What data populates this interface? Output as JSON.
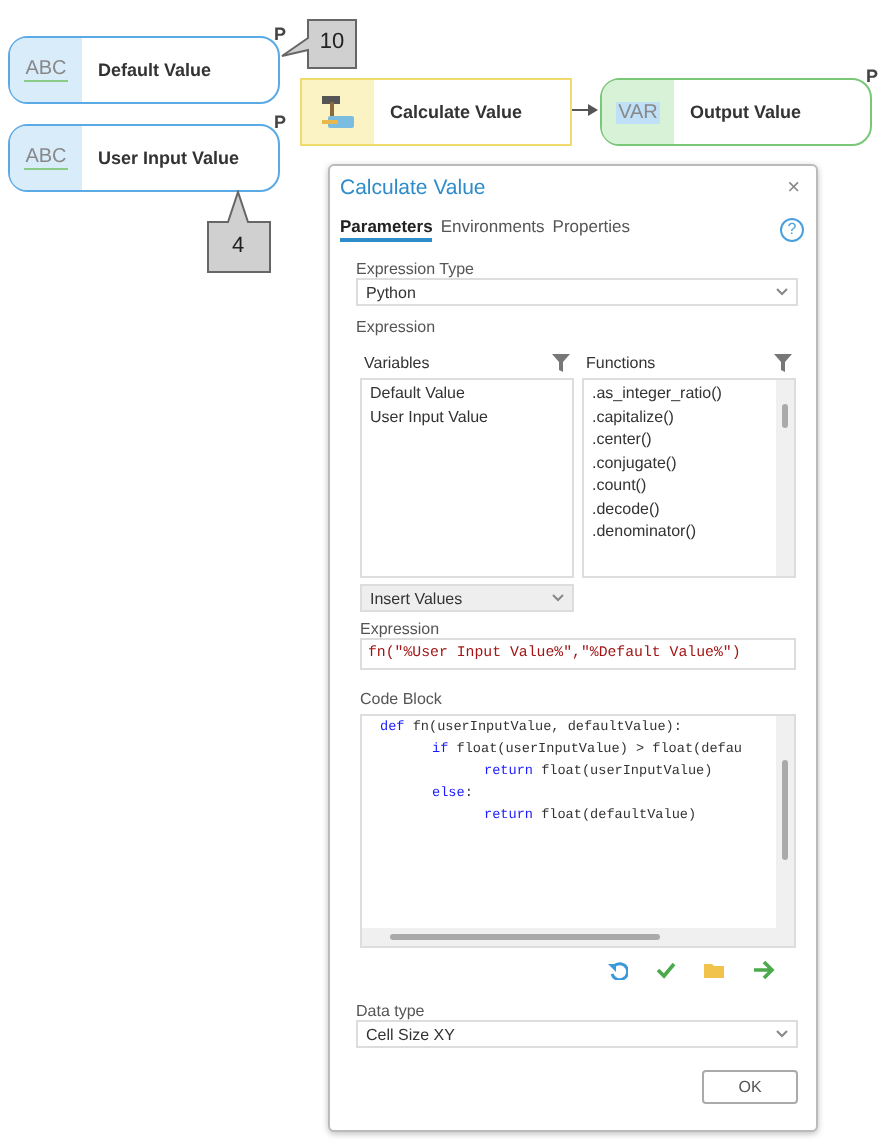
{
  "nodes": [
    {
      "kind": "string",
      "badge": "ABC",
      "label": "Default Value",
      "parameter": "P"
    },
    {
      "kind": "string",
      "badge": "ABC",
      "label": "User Input Value",
      "parameter": "P"
    },
    {
      "kind": "tool",
      "label": "Calculate Value"
    },
    {
      "kind": "variable",
      "badge": "VAR",
      "label": "Output Value",
      "parameter": "P"
    }
  ],
  "callouts": [
    {
      "text": "10"
    },
    {
      "text": "4"
    }
  ],
  "dialog": {
    "title": "Calculate Value",
    "close": "×",
    "help": "?",
    "tabs": [
      {
        "label": "Parameters",
        "selected": true
      },
      {
        "label": "Environments",
        "selected": false
      },
      {
        "label": "Properties",
        "selected": false
      }
    ],
    "expression_type": {
      "label": "Expression Type",
      "value": "Python"
    },
    "expression_section": "Expression",
    "variables": {
      "label": "Variables",
      "items": [
        "Default Value",
        "User Input Value"
      ]
    },
    "functions": {
      "label": "Functions",
      "items": [
        ".as_integer_ratio()",
        ".capitalize()",
        ".center()",
        ".conjugate()",
        ".count()",
        ".decode()",
        ".denominator()"
      ]
    },
    "insert": {
      "value": "Insert Values"
    },
    "expression": {
      "label": "Expression",
      "value": "fn(\"%User Input Value%\",\"%Default Value%\")"
    },
    "code_block": {
      "label": "Code Block",
      "lines": [
        {
          "keyword": "def",
          "code": " fn(userInputValue, defaultValue):",
          "children": [
            {
              "keyword": "if",
              "code": " float(userInputValue) > float(defau",
              "children": [
                {
                  "keyword": "return",
                  "code": " float(userInputValue)"
                }
              ]
            },
            {
              "keyword": "else",
              "code": ":",
              "children": [
                {
                  "keyword": "return",
                  "code": " float(defaultValue)"
                }
              ]
            }
          ]
        }
      ]
    },
    "data_type": {
      "label": "Data type",
      "value": "Cell Size XY"
    },
    "ok": "OK"
  }
}
